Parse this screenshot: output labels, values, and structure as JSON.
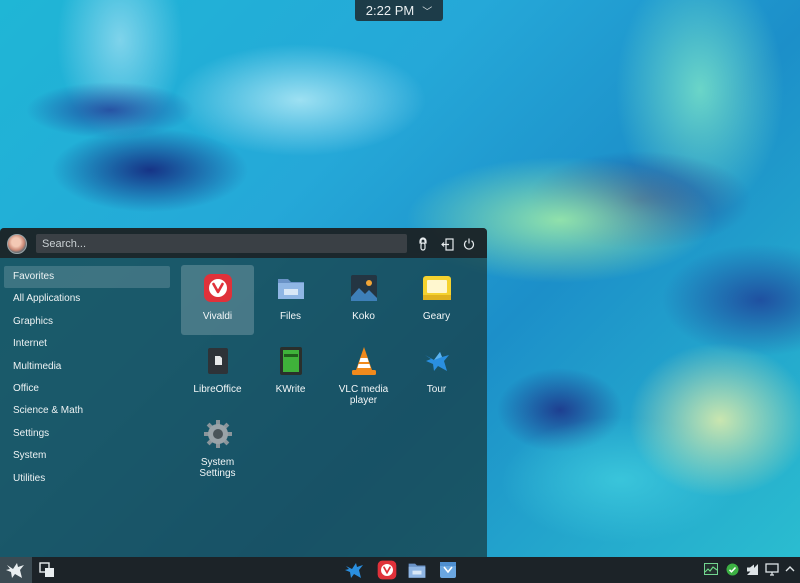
{
  "panel": {
    "clock": "2:22 PM",
    "clock_menu_icon": "chevron-down-icon"
  },
  "menu": {
    "search_placeholder": "Search...",
    "header_buttons": [
      "lock-icon",
      "logout-icon",
      "power-icon"
    ],
    "categories": [
      "Favorites",
      "All Applications",
      "Graphics",
      "Internet",
      "Multimedia",
      "Office",
      "Science & Math",
      "Settings",
      "System",
      "Utilities"
    ],
    "active_category": "Favorites",
    "apps": [
      {
        "label": "Vivaldi",
        "icon": "vivaldi-icon"
      },
      {
        "label": "Files",
        "icon": "files-folder-icon"
      },
      {
        "label": "Koko",
        "icon": "koko-image-viewer-icon"
      },
      {
        "label": "Geary",
        "icon": "geary-mail-icon"
      },
      {
        "label": "LibreOffice",
        "icon": "libreoffice-icon"
      },
      {
        "label": "KWrite",
        "icon": "kwrite-notepad-icon"
      },
      {
        "label": "VLC media player",
        "icon": "vlc-cone-icon"
      },
      {
        "label": "Tour",
        "icon": "tour-bird-icon"
      },
      {
        "label": "System Settings",
        "icon": "system-settings-gear-icon"
      }
    ],
    "selected_app": "Vivaldi"
  },
  "taskbar": {
    "launchers": [
      "bird-launcher-icon",
      "virtual-desktops-icon",
      "bird-icon",
      "vivaldi-icon",
      "files-folder-icon",
      "store-bag-icon"
    ],
    "tray": [
      "system-monitor-icon",
      "update-check-icon",
      "network-icon",
      "volume-icon",
      "display-icon",
      "chevron-up-icon"
    ]
  },
  "colors": {
    "accent": "#e0313a",
    "menu_bg": "#163a40",
    "taskbar_bg": "#1c2328",
    "update_ok": "#3cb043"
  }
}
